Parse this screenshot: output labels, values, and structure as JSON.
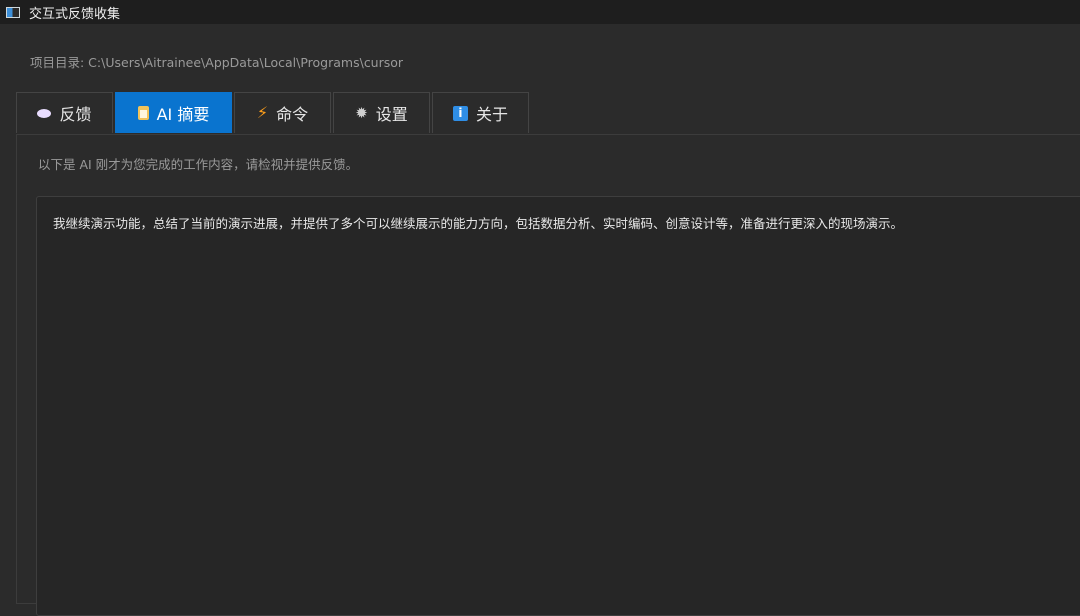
{
  "titlebar": {
    "title": "交互式反馈收集",
    "icon": "window-icon"
  },
  "project_dir": "项目目录: C:\\Users\\Aitrainee\\AppData\\Local\\Programs\\cursor",
  "tabs": [
    {
      "label": "反馈",
      "icon": "speech-bubble-icon"
    },
    {
      "label": "AI 摘要",
      "icon": "clipboard-icon"
    },
    {
      "label": "命令",
      "icon": "lightning-icon"
    },
    {
      "label": "设置",
      "icon": "gear-icon"
    },
    {
      "label": "关于",
      "icon": "info-icon"
    }
  ],
  "active_tab": "AI 摘要",
  "intro_text": "以下是 AI 刚才为您完成的工作内容，请检视并提供反馈。",
  "summary_text": "我继续演示功能，总结了当前的演示进展，并提供了多个可以继续展示的能力方向，包括数据分析、实时编码、创意设计等，准备进行更深入的现场演示。",
  "colors": {
    "background": "#2b2b2b",
    "titlebar": "#1e1e1e",
    "accent": "#0a74cf"
  }
}
